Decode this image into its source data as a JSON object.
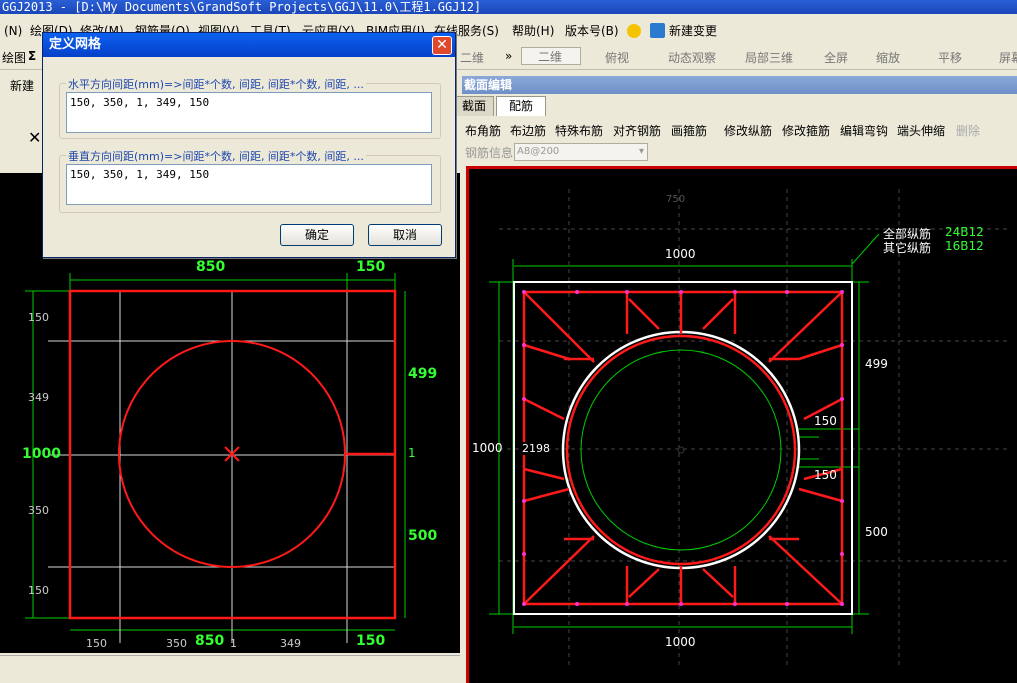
{
  "window": {
    "title": "GGJ2013 - [D:\\My Documents\\GrandSoft Projects\\GGJ\\11.0\\工程1.GGJ12]"
  },
  "menu": {
    "items": [
      "(N)",
      "绘图(D)",
      "修改(M)",
      "钢筋量(Q)",
      "视图(V)",
      "工具(T)",
      "云应用(Y)",
      "BIM应用(I)",
      "在线服务(S)",
      "帮助(H)",
      "版本号(B)",
      "新建变更"
    ]
  },
  "toolbar": {
    "view_2d": "二维",
    "top_view": "俯视",
    "dynamic": "动态观察",
    "local3d": "局部三维",
    "fullscreen": "全屏",
    "zoom": "缩放",
    "pan": "平移",
    "screen": "屏幕",
    "new_label": "新建",
    "draw_label": "绘图",
    "sigma": "Σ"
  },
  "dialog": {
    "title": "定义网格",
    "h_label": "水平方向间距(mm)=>间距*个数, 间距, 间距*个数, 间距, ...",
    "h_value": "150, 350, 1, 349, 150",
    "v_label": "垂直方向间距(mm)=>间距*个数, 间距, 间距*个数, 间距, ...",
    "v_value": "150, 350, 1, 349, 150",
    "ok": "确定",
    "cancel": "取消"
  },
  "section_editor": {
    "title": "截面编辑",
    "tabs": [
      "截面",
      "配筋"
    ],
    "active_tab": "配筋",
    "actions": [
      "布角筋",
      "布边筋",
      "特殊布筋",
      "对齐钢筋",
      "画箍筋",
      "修改纵筋",
      "修改箍筋",
      "编辑弯钩",
      "端头伸缩",
      "删除"
    ],
    "rebar_info_label": "钢筋信息",
    "rebar_info_value": "A8@200"
  },
  "left_drawing": {
    "top_dims": [
      "850",
      "150"
    ],
    "bottom_dims": [
      "150",
      "350",
      "1",
      "349",
      "150"
    ],
    "bottom_big": [
      "850",
      "150"
    ],
    "left_dims": [
      "150",
      "349",
      "350",
      "150"
    ],
    "left_big": "1000",
    "right_dims": [
      "499",
      "500",
      "1"
    ]
  },
  "right_drawing": {
    "all_long_label": "全部纵筋",
    "all_long_value": "24B12",
    "other_long_label": "其它纵筋",
    "other_long_value": "16B12",
    "top_dim": "1000",
    "bottom_dim": "1000",
    "left_dim": "1000",
    "right_dims": [
      "499",
      "500"
    ],
    "inner_dims": [
      "150",
      "150"
    ],
    "circle_dim": "2198",
    "ghost_top": "750"
  },
  "colors": {
    "dim_green": "#00cc00",
    "rebar_red": "#ff1a1a",
    "bright_green": "#33ff33",
    "grid_white": "#e8e8e8"
  }
}
